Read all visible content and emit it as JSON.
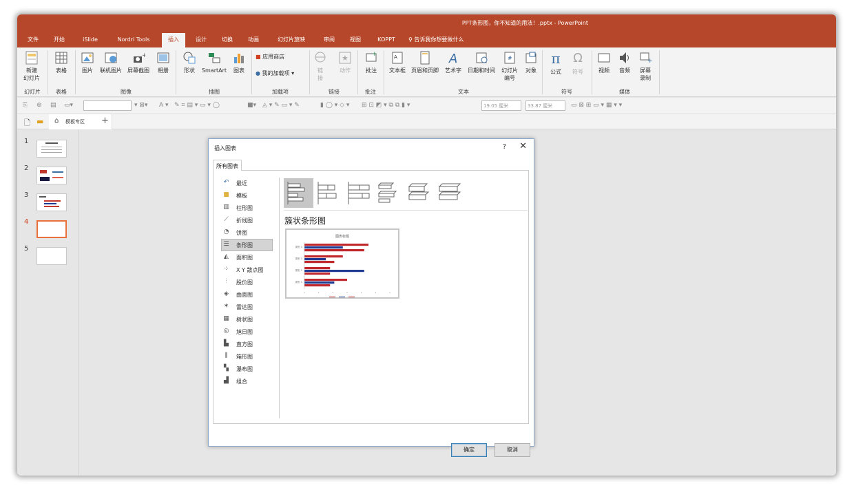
{
  "window": {
    "title": "PPT条形图，你不知道的用法！.pptx  -  PowerPoint"
  },
  "tabs": [
    "文件",
    "开始",
    "iSlide",
    "Nordri Tools",
    "插入",
    "设计",
    "切换",
    "动画",
    "幻灯片放映",
    "审阅",
    "视图",
    "KOPPT"
  ],
  "tell_me": "告诉我你想要做什么",
  "ribbon": {
    "new_slide": "新建\n幻灯片",
    "table": "表格",
    "picture": "图片",
    "online_picture": "联机图片",
    "screenshot": "屏幕截图",
    "album": "相册",
    "shapes": "形状",
    "smartart": "SmartArt",
    "chart": "图表",
    "store": "应用商店",
    "my_addins": "我的加载项",
    "link": "链\n接",
    "action": "动作",
    "comment": "批注",
    "textbox": "文本框",
    "header_footer": "页眉和页脚",
    "wordart": "艺术字",
    "datetime": "日期和时间",
    "slide_number": "幻灯片\n编号",
    "object": "对象",
    "equation": "公式",
    "symbol": "符号",
    "video": "视频",
    "audio": "音频",
    "screen_record": "屏幕\n录制",
    "groups": {
      "slides": "幻灯片",
      "tables": "表格",
      "images": "图像",
      "illustrations": "插图",
      "addins": "加载项",
      "links": "链接",
      "comments": "批注",
      "text": "文本",
      "symbols": "符号",
      "media": "媒体"
    }
  },
  "toolbar": {
    "height": "19.05 厘米",
    "width": "33.87 厘米"
  },
  "filetabs": {
    "template_zone": "模板专区"
  },
  "slides": [
    "1",
    "2",
    "3",
    "4",
    "5"
  ],
  "dialog": {
    "title": "插入图表",
    "help": "?",
    "close": "✕",
    "tab": "所有图表",
    "chart_types": [
      "最近",
      "模板",
      "柱形图",
      "折线图",
      "饼图",
      "条形图",
      "面积图",
      "X Y 散点图",
      "股价图",
      "曲面图",
      "雷达图",
      "树状图",
      "旭日图",
      "直方图",
      "箱形图",
      "瀑布图",
      "组合"
    ],
    "selected_subtype": "簇状条形图",
    "preview_title": "图表标题",
    "preview_categories": [
      "类别 4",
      "类别 3",
      "类别 2",
      "类别 1"
    ],
    "ok": "确定",
    "cancel": "取消"
  }
}
